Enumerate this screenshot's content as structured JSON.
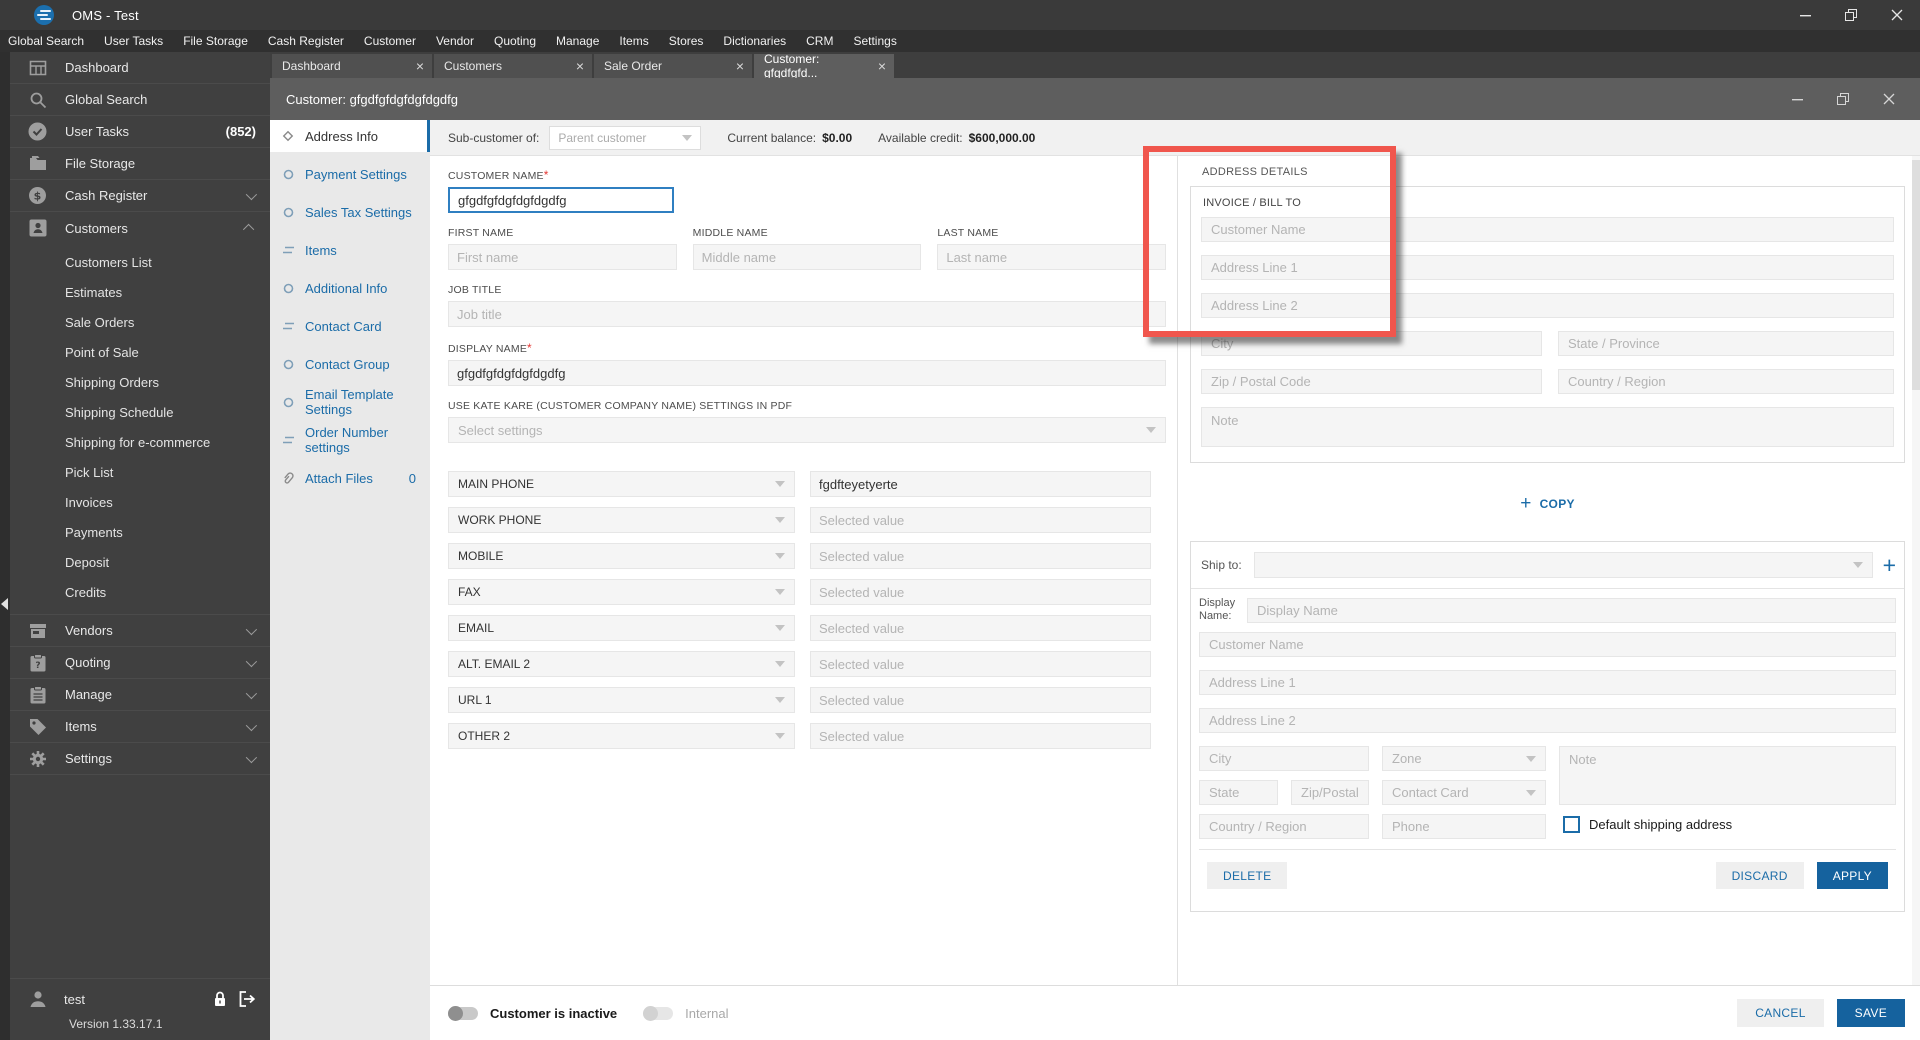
{
  "titlebar": {
    "title": "OMS - Test"
  },
  "menubar": {
    "items": [
      "Global Search",
      "User Tasks",
      "File Storage",
      "Cash Register",
      "Customer",
      "Vendor",
      "Quoting",
      "Manage",
      "Items",
      "Stores",
      "Dictionaries",
      "CRM",
      "Settings"
    ]
  },
  "sidebar": {
    "main": [
      {
        "label": "Dashboard"
      },
      {
        "label": "Global Search"
      },
      {
        "label": "User Tasks",
        "badge": "(852)"
      },
      {
        "label": "File Storage"
      },
      {
        "label": "Cash Register"
      },
      {
        "label": "Customers"
      }
    ],
    "customers_sub": [
      "Customers List",
      "Estimates",
      "Sale Orders",
      "Point of Sale",
      "Shipping Orders",
      "Shipping Schedule",
      "Shipping for e-commerce",
      "Pick List",
      "Invoices",
      "Payments",
      "Deposit",
      "Credits"
    ],
    "lower": [
      "Vendors",
      "Quoting",
      "Manage",
      "Items",
      "Settings"
    ],
    "user": "test",
    "version": "Version 1.33.17.1"
  },
  "tabs": [
    {
      "label": "Dashboard"
    },
    {
      "label": "Customers"
    },
    {
      "label": "Sale Order"
    },
    {
      "label": "Customer: gfgdfgfd..."
    }
  ],
  "dialog": {
    "title": "Customer: gfgdfgfdgfdgfdgdfg",
    "toolbar": {
      "subcustomer_label": "Sub-customer of:",
      "subcustomer_placeholder": "Parent customer",
      "balance_label": "Current balance:",
      "balance_value": "$0.00",
      "credit_label": "Available credit:",
      "credit_value": "$600,000.00"
    },
    "nav": [
      {
        "label": "Address Info"
      },
      {
        "label": "Payment Settings"
      },
      {
        "label": "Sales Tax Settings"
      },
      {
        "label": "Items"
      },
      {
        "label": "Additional Info"
      },
      {
        "label": "Contact Card"
      },
      {
        "label": "Contact Group"
      },
      {
        "label": "Email Template Settings"
      },
      {
        "label": "Order Number settings"
      },
      {
        "label": "Attach Files",
        "badge": "0"
      }
    ],
    "form": {
      "customer_name": {
        "label": "CUSTOMER NAME",
        "value": "gfgdfgfdgfdgfdgdfg"
      },
      "first_name": {
        "label": "FIRST NAME",
        "placeholder": "First name"
      },
      "middle_name": {
        "label": "MIDDLE NAME",
        "placeholder": "Middle name"
      },
      "last_name": {
        "label": "LAST NAME",
        "placeholder": "Last name"
      },
      "job_title": {
        "label": "JOB TITLE",
        "placeholder": "Job title"
      },
      "display_name": {
        "label": "DISPLAY NAME",
        "value": "gfgdfgfdgfdgfdgdfg"
      },
      "pdf_settings": {
        "label": "USE KATE KARE (CUSTOMER COMPANY NAME) SETTINGS IN PDF",
        "placeholder": "Select settings"
      },
      "phones": [
        {
          "type": "MAIN PHONE",
          "value": "fgdfteyetyerte"
        },
        {
          "type": "WORK PHONE",
          "placeholder": "Selected value"
        },
        {
          "type": "MOBILE",
          "placeholder": "Selected value"
        },
        {
          "type": "FAX",
          "placeholder": "Selected value"
        },
        {
          "type": "EMAIL",
          "placeholder": "Selected value"
        },
        {
          "type": "ALT. EMAIL 2",
          "placeholder": "Selected value"
        },
        {
          "type": "URL 1",
          "placeholder": "Selected value"
        },
        {
          "type": "OTHER 2",
          "placeholder": "Selected value"
        }
      ]
    },
    "address": {
      "section_title": "ADDRESS DETAILS",
      "invoice": {
        "title": "INVOICE / BILL TO",
        "customer_name": "Customer Name",
        "address1": "Address Line 1",
        "address2": "Address Line 2",
        "city": "City",
        "state": "State / Province",
        "zip": "Zip / Postal Code",
        "country": "Country / Region",
        "note": "Note"
      },
      "copy_label": "COPY",
      "shipto": {
        "label": "Ship to:",
        "display_name_label": "Display Name:",
        "display_name": "Display Name",
        "customer_name": "Customer Name",
        "address1": "Address Line 1",
        "address2": "Address Line 2",
        "city": "City",
        "zone": "Zone",
        "note": "Note",
        "state": "State",
        "zip": "Zip/Postal",
        "contact_card": "Contact Card",
        "country": "Country / Region",
        "phone": "Phone",
        "default_checkbox": "Default shipping address",
        "delete": "DELETE",
        "discard": "DISCARD",
        "apply": "APPLY"
      }
    },
    "footer": {
      "inactive_label": "Customer is inactive",
      "internal_label": "Internal",
      "cancel": "CANCEL",
      "save": "SAVE"
    }
  },
  "colors": {
    "accent": "#15629e",
    "link": "#1b6ca8",
    "annotation": "#f0564d"
  }
}
